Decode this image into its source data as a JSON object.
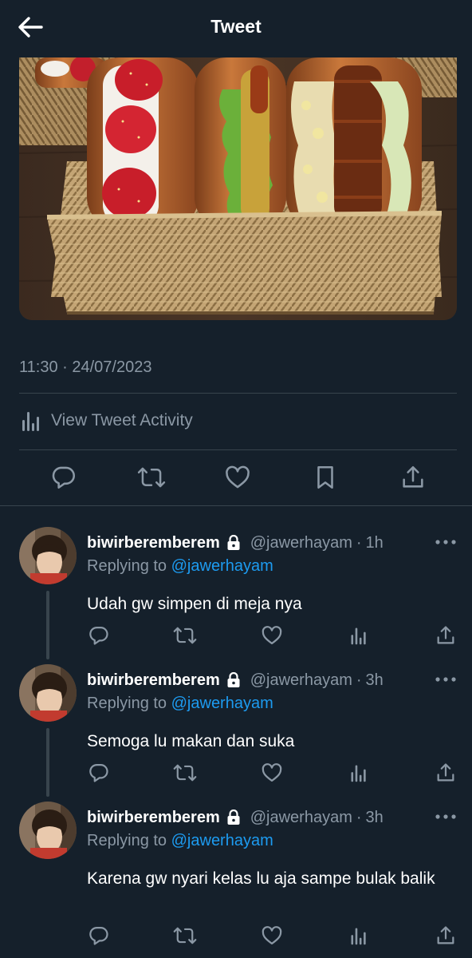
{
  "header": {
    "title": "Tweet",
    "back_icon": "arrow-left-icon"
  },
  "tweet": {
    "timestamp": "11:30 · 24/07/2023",
    "activity_label": "View Tweet Activity",
    "actions": [
      "reply-icon",
      "retweet-icon",
      "like-icon",
      "bookmark-icon",
      "share-icon"
    ]
  },
  "replies": [
    {
      "name": "biwirberemberem",
      "handle": "@jawerhayam",
      "time": "1h",
      "replying_prefix": "Replying to",
      "replying_to": "@jawerhayam",
      "text": "Udah gw simpen di meja nya"
    },
    {
      "name": "biwirberemberem",
      "handle": "@jawerhayam",
      "time": "3h",
      "replying_prefix": "Replying to",
      "replying_to": "@jawerhayam",
      "text": "Semoga lu makan dan suka"
    },
    {
      "name": "biwirberemberem",
      "handle": "@jawerhayam",
      "time": "3h",
      "replying_prefix": "Replying to",
      "replying_to": "@jawerhayam",
      "text": "Karena gw nyari kelas lu aja sampe bulak balik"
    }
  ],
  "colors": {
    "background": "#15202b",
    "secondary_text": "#8b98a5",
    "link": "#1d9bf0",
    "divider": "#38444d"
  }
}
